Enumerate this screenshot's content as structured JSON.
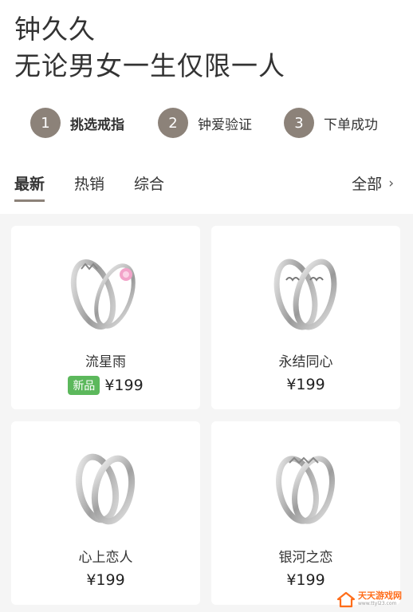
{
  "header": {
    "brand": "钟久久",
    "slogan": "无论男女一生仅限一人"
  },
  "steps": [
    {
      "num": "1",
      "label": "挑选戒指"
    },
    {
      "num": "2",
      "label": "钟爱验证"
    },
    {
      "num": "3",
      "label": "下单成功"
    }
  ],
  "tabs": {
    "items": [
      "最新",
      "热销",
      "综合"
    ],
    "all_label": "全部",
    "all_chevron": "›"
  },
  "products": [
    {
      "name": "流星雨",
      "price": "¥199",
      "badge": "新品",
      "icon": "ring-pair-pink-gem-icon"
    },
    {
      "name": "永结同心",
      "price": "¥199",
      "icon": "ring-pair-heart-icon"
    },
    {
      "name": "心上恋人",
      "price": "¥199",
      "icon": "ring-pair-twist-icon"
    },
    {
      "name": "银河之恋",
      "price": "¥199",
      "icon": "ring-pair-wave-icon"
    }
  ],
  "watermark": {
    "text": "天天游戏网",
    "sub": "www.ttyl23.com"
  },
  "colors": {
    "accent": "#8c8279",
    "badge": "#5cb85c",
    "background": "#f5f5f5"
  }
}
